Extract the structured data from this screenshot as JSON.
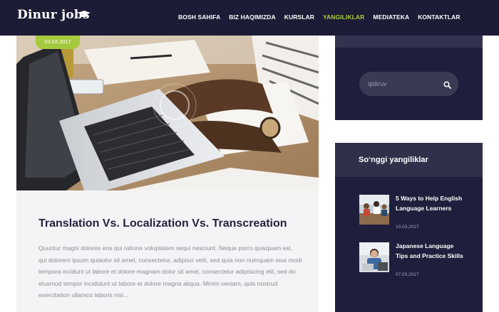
{
  "header": {
    "logo_text": "Dinur jobs",
    "nav": [
      {
        "label": "BOSH SAHIFA"
      },
      {
        "label": "BIZ HAQIMIZDA"
      },
      {
        "label": "KURSLAR"
      },
      {
        "label": "YANGILIKLAR"
      },
      {
        "label": "MEDIATEKA"
      },
      {
        "label": "KONTAKTLAR"
      }
    ],
    "active_index": 3
  },
  "post": {
    "date": "03.03.2017",
    "title": "Translation Vs. Localization Vs. Transcreation",
    "excerpt": "Quuntur magni dolores eos qui ratione voluptatem sequi nesciunt. Neque porro quisquam est, qui dolorem ipsum quiaolor sit amet, consectetur, adipisci velit, sed quia non numquam eius modi tempora incidunt ut labore et dolore magnam dolor sit amet, consectetur adipisicing elit, sed do eiusmod tempor incididunt ut labore et dolore magna aliqua. Minim veniam, quis nostrud exercitation ullamco laboris nisi..."
  },
  "sidebar": {
    "search": {
      "placeholder": "qidiruv"
    },
    "recent": {
      "title": "So‘nggi yangiliklar",
      "items": [
        {
          "title": "5 Ways to Help English Language Learners",
          "date": "10.03.2017"
        },
        {
          "title": "Japanese Language Tips and Practice Skills",
          "date": "07.03.2017"
        }
      ]
    }
  },
  "colors": {
    "header_bg": "#1c1c36",
    "accent": "#a5c93c",
    "sidebar_bg": "#1f1f3d",
    "title": "#23233f"
  },
  "icons": {
    "logo_cap": "graduation-cap-icon",
    "search": "search-icon"
  }
}
